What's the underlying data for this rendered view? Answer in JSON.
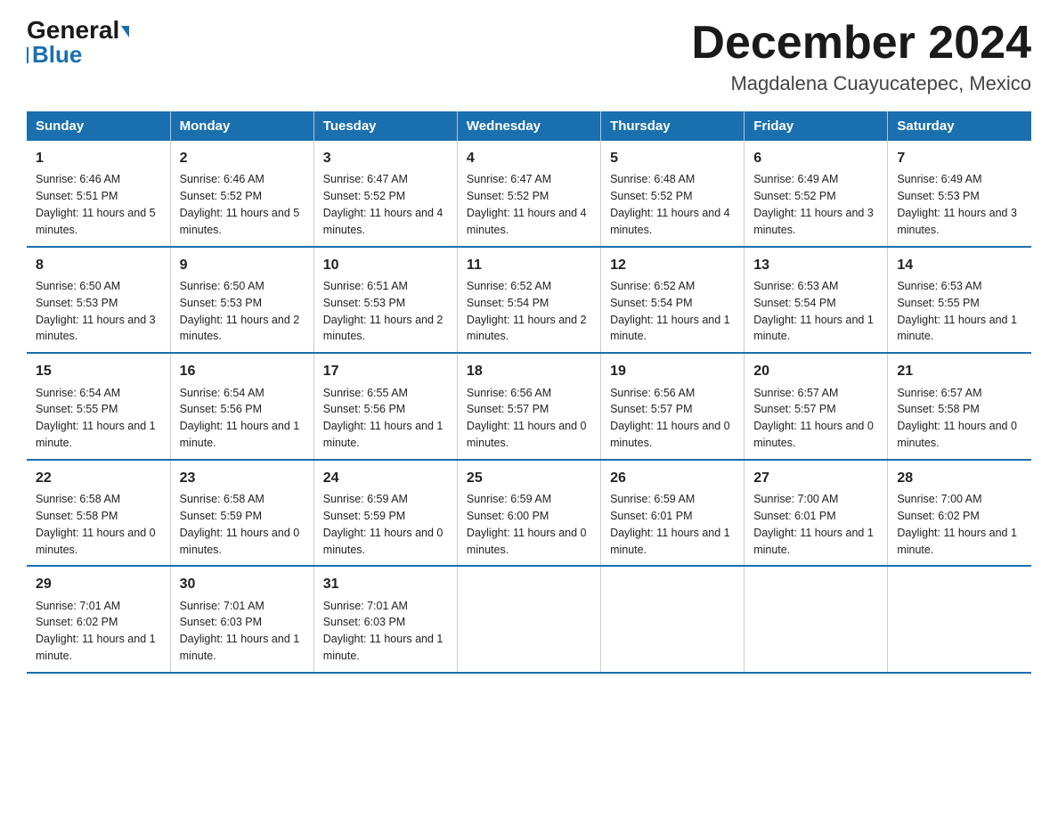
{
  "logo": {
    "general": "General",
    "triangle": "▶",
    "blue": "Blue"
  },
  "title": "December 2024",
  "subtitle": "Magdalena Cuayucatepec, Mexico",
  "weekdays": [
    "Sunday",
    "Monday",
    "Tuesday",
    "Wednesday",
    "Thursday",
    "Friday",
    "Saturday"
  ],
  "weeks": [
    [
      {
        "day": "1",
        "sunrise": "6:46 AM",
        "sunset": "5:51 PM",
        "daylight": "11 hours and 5 minutes."
      },
      {
        "day": "2",
        "sunrise": "6:46 AM",
        "sunset": "5:52 PM",
        "daylight": "11 hours and 5 minutes."
      },
      {
        "day": "3",
        "sunrise": "6:47 AM",
        "sunset": "5:52 PM",
        "daylight": "11 hours and 4 minutes."
      },
      {
        "day": "4",
        "sunrise": "6:47 AM",
        "sunset": "5:52 PM",
        "daylight": "11 hours and 4 minutes."
      },
      {
        "day": "5",
        "sunrise": "6:48 AM",
        "sunset": "5:52 PM",
        "daylight": "11 hours and 4 minutes."
      },
      {
        "day": "6",
        "sunrise": "6:49 AM",
        "sunset": "5:52 PM",
        "daylight": "11 hours and 3 minutes."
      },
      {
        "day": "7",
        "sunrise": "6:49 AM",
        "sunset": "5:53 PM",
        "daylight": "11 hours and 3 minutes."
      }
    ],
    [
      {
        "day": "8",
        "sunrise": "6:50 AM",
        "sunset": "5:53 PM",
        "daylight": "11 hours and 3 minutes."
      },
      {
        "day": "9",
        "sunrise": "6:50 AM",
        "sunset": "5:53 PM",
        "daylight": "11 hours and 2 minutes."
      },
      {
        "day": "10",
        "sunrise": "6:51 AM",
        "sunset": "5:53 PM",
        "daylight": "11 hours and 2 minutes."
      },
      {
        "day": "11",
        "sunrise": "6:52 AM",
        "sunset": "5:54 PM",
        "daylight": "11 hours and 2 minutes."
      },
      {
        "day": "12",
        "sunrise": "6:52 AM",
        "sunset": "5:54 PM",
        "daylight": "11 hours and 1 minute."
      },
      {
        "day": "13",
        "sunrise": "6:53 AM",
        "sunset": "5:54 PM",
        "daylight": "11 hours and 1 minute."
      },
      {
        "day": "14",
        "sunrise": "6:53 AM",
        "sunset": "5:55 PM",
        "daylight": "11 hours and 1 minute."
      }
    ],
    [
      {
        "day": "15",
        "sunrise": "6:54 AM",
        "sunset": "5:55 PM",
        "daylight": "11 hours and 1 minute."
      },
      {
        "day": "16",
        "sunrise": "6:54 AM",
        "sunset": "5:56 PM",
        "daylight": "11 hours and 1 minute."
      },
      {
        "day": "17",
        "sunrise": "6:55 AM",
        "sunset": "5:56 PM",
        "daylight": "11 hours and 1 minute."
      },
      {
        "day": "18",
        "sunrise": "6:56 AM",
        "sunset": "5:57 PM",
        "daylight": "11 hours and 0 minutes."
      },
      {
        "day": "19",
        "sunrise": "6:56 AM",
        "sunset": "5:57 PM",
        "daylight": "11 hours and 0 minutes."
      },
      {
        "day": "20",
        "sunrise": "6:57 AM",
        "sunset": "5:57 PM",
        "daylight": "11 hours and 0 minutes."
      },
      {
        "day": "21",
        "sunrise": "6:57 AM",
        "sunset": "5:58 PM",
        "daylight": "11 hours and 0 minutes."
      }
    ],
    [
      {
        "day": "22",
        "sunrise": "6:58 AM",
        "sunset": "5:58 PM",
        "daylight": "11 hours and 0 minutes."
      },
      {
        "day": "23",
        "sunrise": "6:58 AM",
        "sunset": "5:59 PM",
        "daylight": "11 hours and 0 minutes."
      },
      {
        "day": "24",
        "sunrise": "6:59 AM",
        "sunset": "5:59 PM",
        "daylight": "11 hours and 0 minutes."
      },
      {
        "day": "25",
        "sunrise": "6:59 AM",
        "sunset": "6:00 PM",
        "daylight": "11 hours and 0 minutes."
      },
      {
        "day": "26",
        "sunrise": "6:59 AM",
        "sunset": "6:01 PM",
        "daylight": "11 hours and 1 minute."
      },
      {
        "day": "27",
        "sunrise": "7:00 AM",
        "sunset": "6:01 PM",
        "daylight": "11 hours and 1 minute."
      },
      {
        "day": "28",
        "sunrise": "7:00 AM",
        "sunset": "6:02 PM",
        "daylight": "11 hours and 1 minute."
      }
    ],
    [
      {
        "day": "29",
        "sunrise": "7:01 AM",
        "sunset": "6:02 PM",
        "daylight": "11 hours and 1 minute."
      },
      {
        "day": "30",
        "sunrise": "7:01 AM",
        "sunset": "6:03 PM",
        "daylight": "11 hours and 1 minute."
      },
      {
        "day": "31",
        "sunrise": "7:01 AM",
        "sunset": "6:03 PM",
        "daylight": "11 hours and 1 minute."
      },
      null,
      null,
      null,
      null
    ]
  ]
}
